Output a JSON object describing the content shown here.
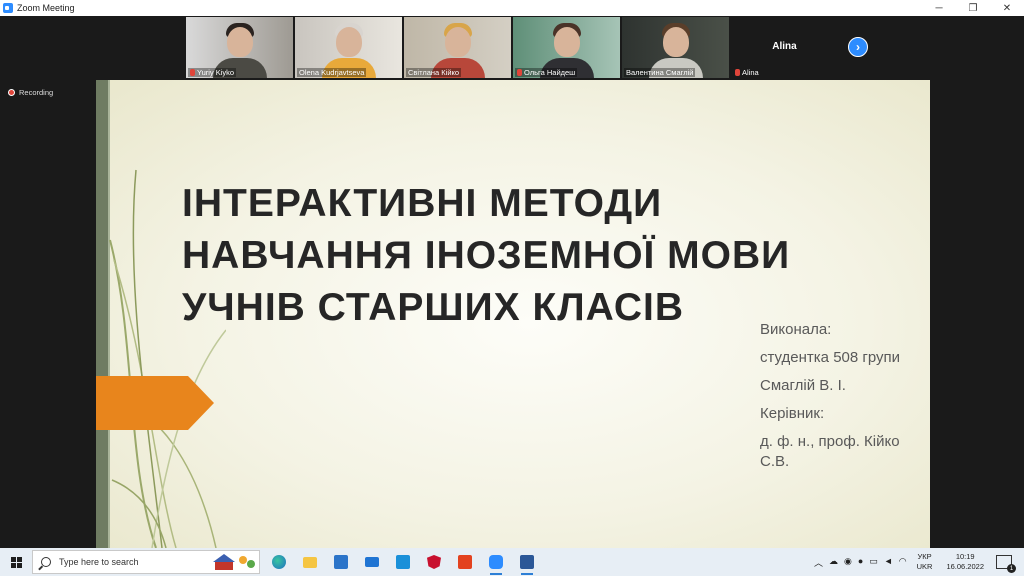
{
  "window": {
    "title": "Zoom Meeting",
    "controls": [
      "─",
      "❐",
      "✕"
    ]
  },
  "participants": [
    {
      "name": "Yuriy Kiyko",
      "muted": true
    },
    {
      "name": "Olena Kudrjavtseva",
      "muted": false
    },
    {
      "name": "Світлана Кійко",
      "muted": false
    },
    {
      "name": "Ольга Найдеш",
      "muted": true
    },
    {
      "name": "Валентина Смаглій",
      "muted": false,
      "active": true
    },
    {
      "name": "Alina",
      "muted": true,
      "video": false,
      "display_name": "Alina"
    }
  ],
  "next_page_icon": "chevron-right",
  "recording": {
    "label": "Recording"
  },
  "slide": {
    "title": "ІНТЕРАКТИВНІ МЕТОДИ НАВЧАННЯ ІНОЗЕМНОЇ МОВИ УЧНІВ СТАРШИХ КЛАСІВ",
    "info": [
      "Виконала:",
      "студентка 508 групи",
      "Смаглій В. І.",
      "Керівник:",
      "д. ф. н., проф. Кійко С.В."
    ],
    "accent_color": "#e8851c"
  },
  "taskbar": {
    "search_placeholder": "Type here to search",
    "apps": [
      "task-view",
      "edge",
      "file-explorer",
      "store",
      "mail",
      "photos",
      "mcafee",
      "office",
      "zoom",
      "word"
    ],
    "language": {
      "top": "УКР",
      "bottom": "UKR"
    },
    "time": "10:19",
    "date": "16.06.2022",
    "notifications": "1"
  }
}
